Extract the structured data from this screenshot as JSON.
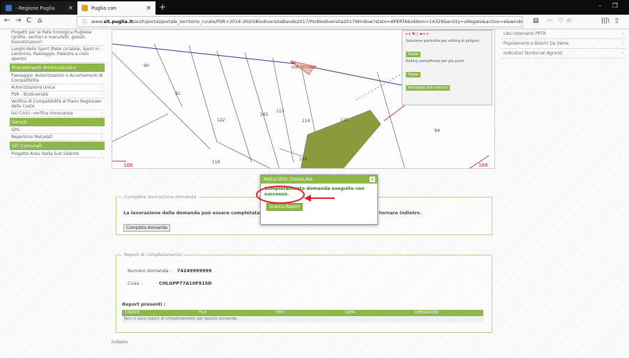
{
  "browser": {
    "tabs": [
      {
        "title": "- Regione Puglia",
        "close": "×"
      },
      {
        "title": "Puglia con",
        "close": "×"
      }
    ],
    "new_tab": "+",
    "url_prefix": "www.",
    "url_domain": "sit.puglia.it",
    "url_rest": "/auth/portal/portale_territorio_rurale/PSR+2014-2020/BiodiversitaBando2017/PsrBiodiversita2017Window?stato=APERTA&iddom=14329&entity=allegato&action=e&windowstate=norma",
    "window_controls": [
      "–",
      "❐"
    ],
    "nav_icons": {
      "back": "←",
      "forward": "→",
      "reload": "C",
      "home": "⌂",
      "menu": "···",
      "pocket": "♡",
      "star": "☆",
      "library": "|||\\",
      "sidebar": "▯"
    },
    "info_icon": "ⓘ"
  },
  "sidebar": {
    "items": [
      {
        "label": "Progetti per la Rete Ecologica Pugliese (grotte, veritari e manufatti, gessili, biocostruzioni)",
        "type": "item"
      },
      {
        "label": "Luoghi dello Sport (Rete ciclabile, Sport in cammino, Paesaggio, Palestre a cielo aperto)",
        "type": "item"
      },
      {
        "label": "Procedimenti Amministrativi",
        "type": "head"
      },
      {
        "label": "Paesaggio: Autorizzazioni e Accertamenti di Compatibilità",
        "type": "item"
      },
      {
        "label": "Autorizzazione Unica",
        "type": "item"
      },
      {
        "label": "PSR - Biodiversità",
        "type": "item"
      },
      {
        "label": "Verifica di Compatibilità al Piano Regionale delle Coste",
        "type": "item"
      },
      {
        "label": "Usi Civici: verifica rinnovanza",
        "type": "item"
      },
      {
        "label": "Servizi",
        "type": "head"
      },
      {
        "label": "GPS",
        "type": "item"
      },
      {
        "label": "Repertorio Metadati",
        "type": "item"
      },
      {
        "label": "SIT Comunali",
        "type": "head"
      },
      {
        "label": "Progetto Area Vasta Sud Salento",
        "type": "item"
      }
    ]
  },
  "right_list": {
    "items": [
      "Libri Interventi PPTR",
      "Popolamenti e Boschi Da Seme",
      "Indicatori Territoriali Agricoli"
    ]
  },
  "map": {
    "parcel_labels": [
      "90",
      "81",
      "122",
      "163",
      "113",
      "114",
      "115",
      "94",
      "148",
      "110",
      "168",
      "168"
    ],
    "highlight_label": "92\nUSB 157 DALE",
    "tools": {
      "row1": "Selezione particelle per editing di poligoni",
      "btn1": "Totale",
      "row2": "Editing semplificato per più punti",
      "btn2": "Totale",
      "btn3": "Visualizza dati nessuni"
    }
  },
  "complete_panel": {
    "legend": "Completa lavorazione domanda",
    "text": "La lavorazione della domanda può essere completata, prima di ... ambiente GIS. Non sarà possibile tornare indietro.",
    "button": "Completa domanda"
  },
  "report_panel": {
    "legend": "Report di completamento",
    "numero_label": "Numero domanda :",
    "numero_value": "74249999999",
    "cuaa_label": "Cuaa :",
    "cuaa_value": "CHLGPP77A10F915D",
    "reports_title": "Report presenti :",
    "columns": [
      "CODICE",
      "FILE",
      "TIPO",
      "DATA",
      "OPERAZIONI"
    ],
    "empty_row": "Non ci sono report di completamento per questa domanda."
  },
  "footer": "Indietro",
  "dialog": {
    "title": "RISULTATO CHIUSURA",
    "close": "×",
    "message": "Completamento domanda eseguito con successo.",
    "button": "Scarica Report"
  },
  "colors": {
    "accent": "#8db64b",
    "annotation": "#e02020",
    "map_green": "#8c9a3e"
  }
}
